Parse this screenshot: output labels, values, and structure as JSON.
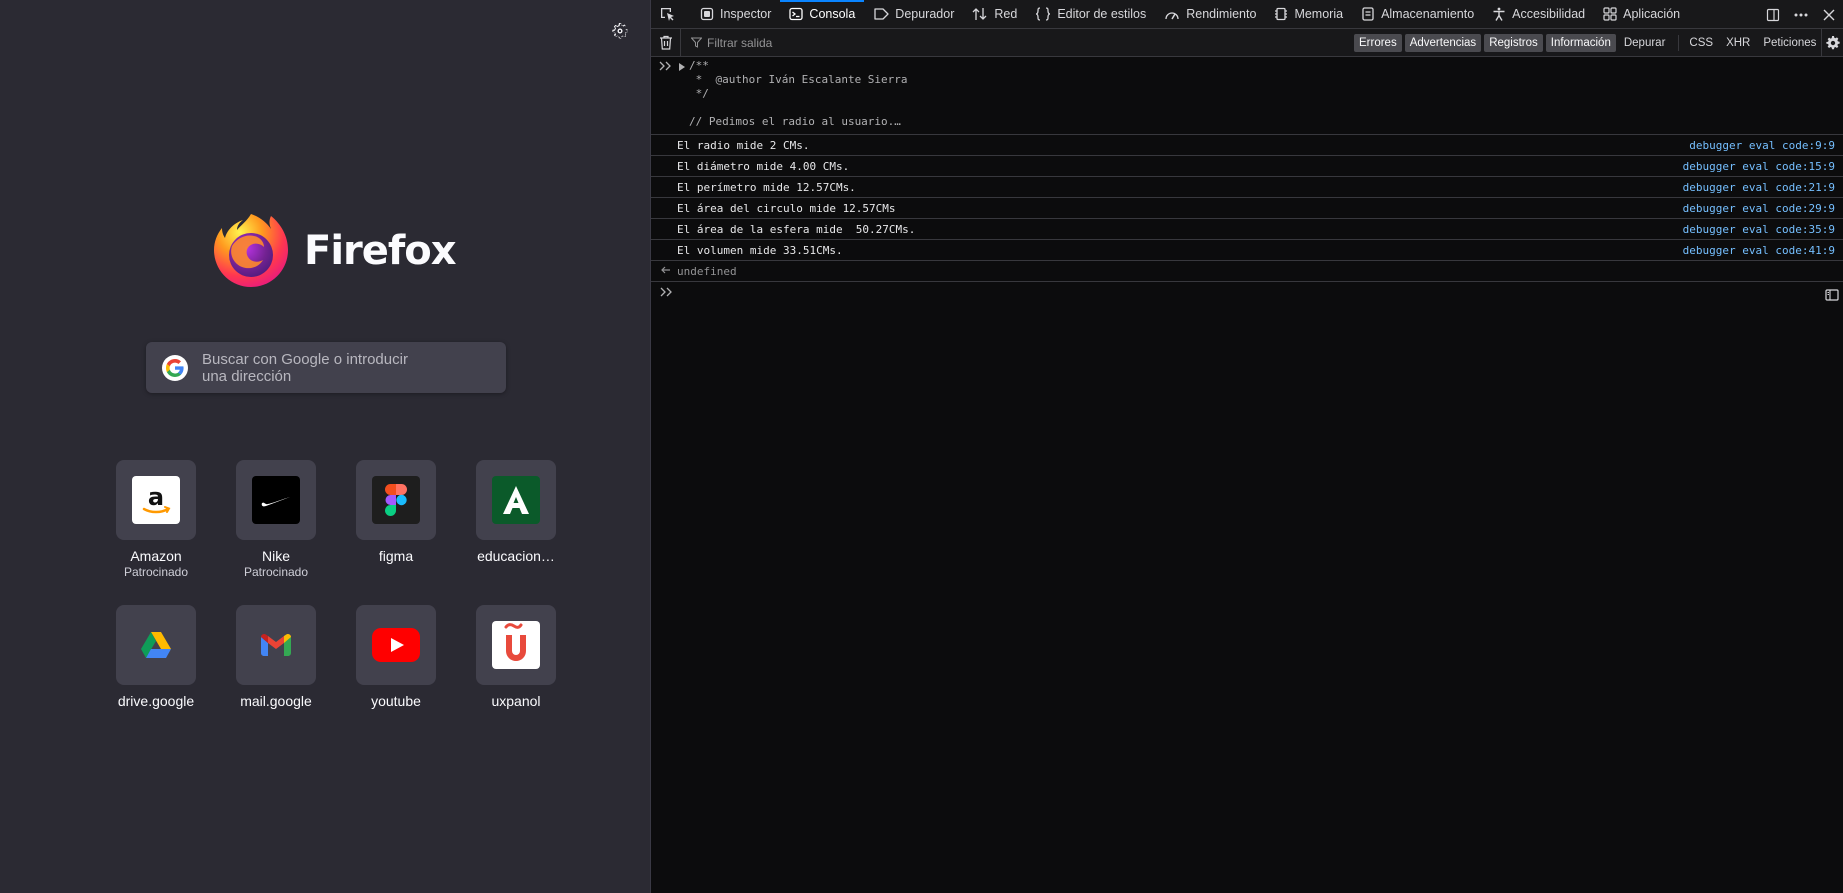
{
  "newtab": {
    "brand": "Firefox",
    "search_placeholder": "Buscar con Google o introducir una dirección",
    "tiles": [
      {
        "label": "Amazon",
        "sub": "Patrocinado",
        "icon": "amazon-icon"
      },
      {
        "label": "Nike",
        "sub": "Patrocinado",
        "icon": "nike-icon"
      },
      {
        "label": "figma",
        "sub": "",
        "icon": "figma-icon"
      },
      {
        "label": "educacion…",
        "sub": "",
        "icon": "junta-andalucia-icon"
      },
      {
        "label": "drive.google",
        "sub": "",
        "icon": "google-drive-icon"
      },
      {
        "label": "mail.google",
        "sub": "",
        "icon": "gmail-icon"
      },
      {
        "label": "youtube",
        "sub": "",
        "icon": "youtube-icon"
      },
      {
        "label": "uxpanol",
        "sub": "",
        "icon": "uxpanol-icon"
      }
    ]
  },
  "devtools": {
    "tabs": [
      "Inspector",
      "Consola",
      "Depurador",
      "Red",
      "Editor de estilos",
      "Rendimiento",
      "Memoria",
      "Almacenamiento",
      "Accesibilidad",
      "Aplicación"
    ],
    "active_tab": "Consola",
    "filter_placeholder": "Filtrar salida",
    "filters": [
      "Errores",
      "Advertencias",
      "Registros",
      "Información",
      "Depurar"
    ],
    "filters_checked": [
      "Errores",
      "Advertencias",
      "Registros",
      "Información"
    ],
    "request_filters": [
      "CSS",
      "XHR",
      "Peticiones"
    ],
    "console": {
      "input_echo": "/**\n *  @author Iván Escalante Sierra\n */\n\n// Pedimos el radio al usuario.…",
      "logs": [
        {
          "message": "El radio mide 2 CMs.",
          "location": "debugger eval code:9:9"
        },
        {
          "message": "El diámetro mide 4.00 CMs.",
          "location": "debugger eval code:15:9"
        },
        {
          "message": "El perímetro mide 12.57CMs.",
          "location": "debugger eval code:21:9"
        },
        {
          "message": "El área del circulo mide 12.57CMs",
          "location": "debugger eval code:29:9"
        },
        {
          "message": "El área de la esfera mide  50.27CMs.",
          "location": "debugger eval code:35:9"
        },
        {
          "message": "El volumen mide 33.51CMs.",
          "location": "debugger eval code:41:9"
        }
      ],
      "result": "undefined"
    }
  },
  "colors": {
    "newtab_bg": "#2b2a33",
    "tile_bg": "#42414d",
    "devtools_bg": "#0c0c0d",
    "accent": "#0a84ff",
    "link": "#75bfff"
  }
}
